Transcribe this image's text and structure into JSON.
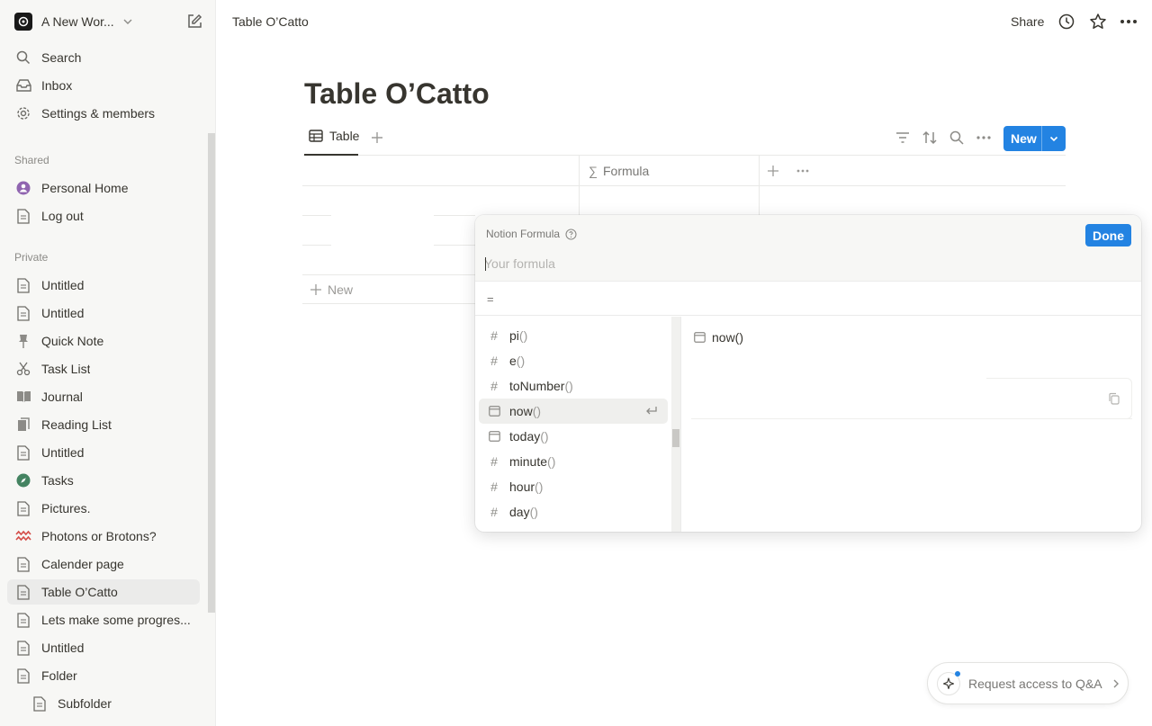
{
  "sidebar": {
    "workspace_name": "A New Wor...",
    "top_items": [
      {
        "label": "Search",
        "icon": "search-icon"
      },
      {
        "label": "Inbox",
        "icon": "inbox-icon"
      },
      {
        "label": "Settings & members",
        "icon": "gear-icon"
      }
    ],
    "shared_label": "Shared",
    "shared_items": [
      {
        "label": "Personal Home",
        "icon": "person-icon"
      },
      {
        "label": "Log out",
        "icon": "page-icon"
      }
    ],
    "private_label": "Private",
    "private_items": [
      {
        "label": "Untitled",
        "icon": "page-icon"
      },
      {
        "label": "Untitled",
        "icon": "page-icon"
      },
      {
        "label": "Quick Note",
        "icon": "pin-icon"
      },
      {
        "label": "Task List",
        "icon": "scissors-icon"
      },
      {
        "label": "Journal",
        "icon": "book-icon"
      },
      {
        "label": "Reading List",
        "icon": "books-icon"
      },
      {
        "label": "Untitled",
        "icon": "page-icon"
      },
      {
        "label": "Tasks",
        "icon": "compass-icon"
      },
      {
        "label": "Pictures.",
        "icon": "page-icon"
      },
      {
        "label": "Photons or Brotons?",
        "icon": "wave-icon"
      },
      {
        "label": "Calender page",
        "icon": "page-icon"
      },
      {
        "label": "Table O’Catto",
        "icon": "page-icon",
        "active": true
      },
      {
        "label": "Lets make some progres...",
        "icon": "page-icon"
      },
      {
        "label": "Untitled",
        "icon": "page-icon"
      },
      {
        "label": "Folder",
        "icon": "page-icon"
      },
      {
        "label": "Subfolder",
        "icon": "page-icon"
      }
    ]
  },
  "topbar": {
    "breadcrumb": "Table O’Catto",
    "share_label": "Share"
  },
  "page": {
    "title": "Table O’Catto",
    "view_tab_label": "Table",
    "new_button_label": "New",
    "columns": [
      {
        "label": "Formula",
        "icon": "sigma-icon"
      }
    ],
    "add_row_label": "New"
  },
  "formula_popup": {
    "title": "Notion Formula",
    "input_placeholder": "Your formula",
    "input_value": "",
    "done_label": "Done",
    "result_prefix": "=",
    "functions": [
      {
        "name": "pi",
        "paren": "()",
        "type_icon": "number-icon"
      },
      {
        "name": "e",
        "paren": "()",
        "type_icon": "number-icon"
      },
      {
        "name": "toNumber",
        "paren": "()",
        "type_icon": "number-icon"
      },
      {
        "name": "now",
        "paren": "()",
        "type_icon": "calendar-icon",
        "selected": true
      },
      {
        "name": "today",
        "paren": "()",
        "type_icon": "calendar-icon"
      },
      {
        "name": "minute",
        "paren": "()",
        "type_icon": "number-icon"
      },
      {
        "name": "hour",
        "paren": "()",
        "type_icon": "number-icon"
      },
      {
        "name": "day",
        "paren": "()",
        "type_icon": "number-icon"
      }
    ],
    "detail_title": "now()"
  },
  "qa_button": {
    "label": "Request access to Q&A"
  },
  "colors": {
    "accent": "#2383e2",
    "sidebar_bg": "#f7f7f5",
    "text": "#37352f"
  }
}
